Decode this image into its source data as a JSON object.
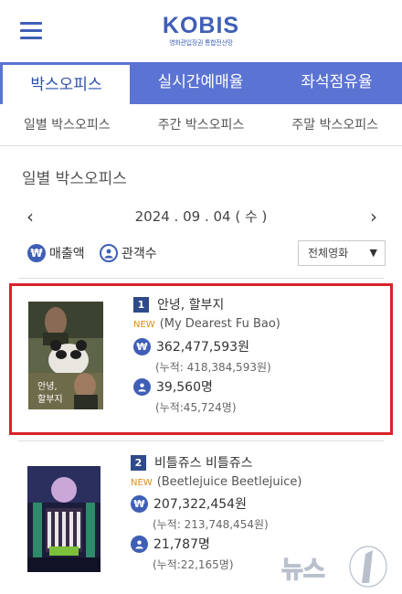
{
  "header": {
    "logo": "KOBIS",
    "logo_sub": "영화관입장권 통합전산망"
  },
  "main_tabs": [
    {
      "label": "박스오피스",
      "active": true
    },
    {
      "label": "실시간예매율",
      "active": false
    },
    {
      "label": "좌석점유율",
      "active": false
    }
  ],
  "sub_tabs": [
    {
      "label": "일별 박스오피스"
    },
    {
      "label": "주간 박스오피스"
    },
    {
      "label": "주말 박스오피스"
    }
  ],
  "section_title": "일별 박스오피스",
  "date": {
    "text": "2024 . 09 . 04 ( 수 )",
    "prev": "‹",
    "next": "›"
  },
  "filters": {
    "sales_icon": "₩",
    "sales_label": "매출액",
    "audience_label": "관객수",
    "select_value": "전체영화",
    "select_caret": "▼"
  },
  "movies": [
    {
      "rank": "1",
      "title": "안녕, 할부지",
      "new_badge": "NEW",
      "original_title": "(My Dearest Fu Bao)",
      "sales_icon": "₩",
      "sales": "362,477,593원",
      "sales_cum": "(누적: 418,384,593원)",
      "audience": "39,560명",
      "audience_cum": "(누적:45,724명)",
      "poster_text": "안녕,\n할부지"
    },
    {
      "rank": "2",
      "title": "비틀쥬스 비틀쥬스",
      "new_badge": "NEW",
      "original_title": "(Beetlejuice Beetlejuice)",
      "sales_icon": "₩",
      "sales": "207,322,454원",
      "sales_cum": "(누적: 213,748,454원)",
      "audience": "21,787명",
      "audience_cum": "(누적:22,165명)"
    }
  ],
  "watermark": "뉴스1",
  "colors": {
    "brand": "#3f5fb6",
    "tab_bar": "#5b73d3",
    "highlight": "#d8232a",
    "new": "#e08a1e"
  }
}
